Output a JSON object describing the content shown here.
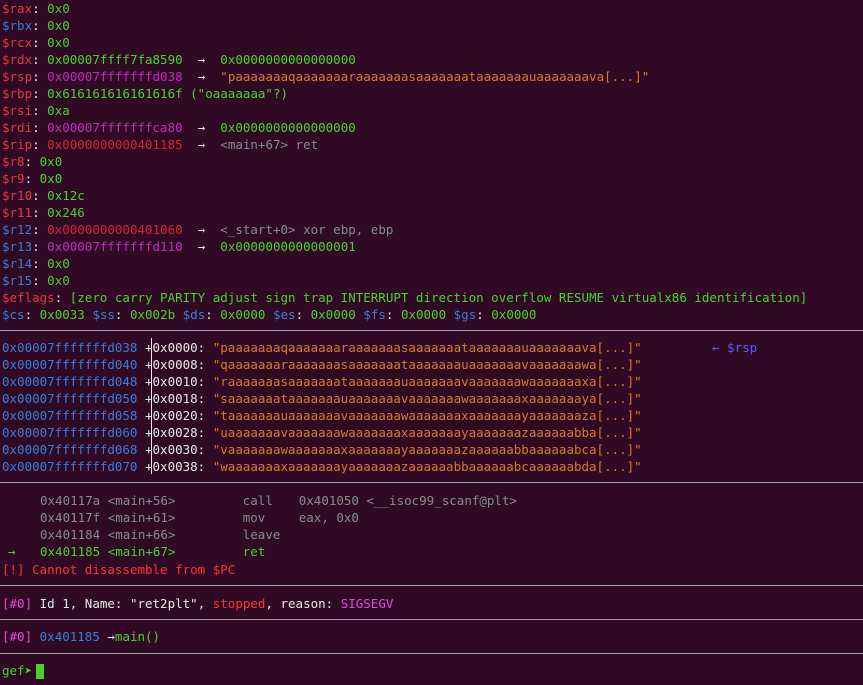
{
  "registers": [
    {
      "name": "$rax",
      "name_color": "red",
      "value": "0x0",
      "value_color": "green",
      "arrow": "",
      "deref": "",
      "deref_color": ""
    },
    {
      "name": "$rbx",
      "name_color": "blue",
      "value": "0x0",
      "value_color": "green",
      "arrow": "",
      "deref": "",
      "deref_color": ""
    },
    {
      "name": "$rcx",
      "name_color": "red",
      "value": "0x0",
      "value_color": "green",
      "arrow": "",
      "deref": "",
      "deref_color": ""
    },
    {
      "name": "$rdx",
      "name_color": "red",
      "value": "0x00007ffff7fa8590",
      "value_color": "green",
      "arrow": "→",
      "deref": "0x0000000000000000",
      "deref_color": "green"
    },
    {
      "name": "$rsp",
      "name_color": "red",
      "value": "0x00007fffffffd038",
      "value_color": "purple",
      "arrow": "→",
      "deref": "\"paaaaaaaqaaaaaaaraaaaaaasaaaaaaataaaaaaauaaaaaaava[...]\"",
      "deref_color": "orange"
    },
    {
      "name": "$rbp",
      "name_color": "red",
      "value": "0x616161616161616f (\"oaaaaaaa\"?)",
      "value_color": "green",
      "arrow": "",
      "deref": "",
      "deref_color": ""
    },
    {
      "name": "$rsi",
      "name_color": "red",
      "value": "0xa",
      "value_color": "green",
      "arrow": "",
      "deref": "",
      "deref_color": ""
    },
    {
      "name": "$rdi",
      "name_color": "red",
      "value": "0x00007fffffffca80",
      "value_color": "purple",
      "arrow": "→",
      "deref": "0x0000000000000000",
      "deref_color": "green"
    },
    {
      "name": "$rip",
      "name_color": "red",
      "value": "0x0000000000401185",
      "value_color": "darkred",
      "arrow": "→",
      "deref": "<main+67> ret",
      "deref_color": "grey"
    },
    {
      "name": "$r8",
      "name_color": "red",
      "value": "0x0",
      "value_color": "green",
      "arrow": "",
      "deref": "",
      "deref_color": ""
    },
    {
      "name": "$r9",
      "name_color": "red",
      "value": "0x0",
      "value_color": "green",
      "arrow": "",
      "deref": "",
      "deref_color": ""
    },
    {
      "name": "$r10",
      "name_color": "red",
      "value": "0x12c",
      "value_color": "green",
      "arrow": "",
      "deref": "",
      "deref_color": ""
    },
    {
      "name": "$r11",
      "name_color": "red",
      "value": "0x246",
      "value_color": "green",
      "arrow": "",
      "deref": "",
      "deref_color": ""
    },
    {
      "name": "$r12",
      "name_color": "blue",
      "value": "0x0000000000401060",
      "value_color": "darkred",
      "arrow": "→",
      "deref": "<_start+0> xor ebp, ebp",
      "deref_color": "grey"
    },
    {
      "name": "$r13",
      "name_color": "blue",
      "value": "0x00007fffffffd110",
      "value_color": "purple",
      "arrow": "→",
      "deref": "0x0000000000000001",
      "deref_color": "green"
    },
    {
      "name": "$r14",
      "name_color": "blue",
      "value": "0x0",
      "value_color": "green",
      "arrow": "",
      "deref": "",
      "deref_color": ""
    },
    {
      "name": "$r15",
      "name_color": "blue",
      "value": "0x0",
      "value_color": "green",
      "arrow": "",
      "deref": "",
      "deref_color": ""
    }
  ],
  "eflags": {
    "name": "$eflags",
    "value": "[zero carry PARITY adjust sign trap INTERRUPT direction overflow RESUME virtualx86 identification]"
  },
  "segments": [
    {
      "name": "$cs",
      "value": "0x0033"
    },
    {
      "name": "$ss",
      "value": "0x002b"
    },
    {
      "name": "$ds",
      "value": "0x0000"
    },
    {
      "name": "$es",
      "value": "0x0000"
    },
    {
      "name": "$fs",
      "value": "0x0000"
    },
    {
      "name": "$gs",
      "value": "0x0000"
    }
  ],
  "stack": [
    {
      "addr": "0x00007fffffffd038",
      "offset": "+0x0000:",
      "value": "\"paaaaaaaqaaaaaaaraaaaaaasaaaaaaataaaaaaauaaaaaaava[...]\"",
      "marker": "← $rsp"
    },
    {
      "addr": "0x00007fffffffd040",
      "offset": "+0x0008:",
      "value": "\"qaaaaaaaraaaaaaasaaaaaaataaaaaaauaaaaaaavaaaaaaawa[...]\"",
      "marker": ""
    },
    {
      "addr": "0x00007fffffffd048",
      "offset": "+0x0010:",
      "value": "\"raaaaaaasaaaaaaataaaaaaauaaaaaaavaaaaaaawaaaaaaaxa[...]\"",
      "marker": ""
    },
    {
      "addr": "0x00007fffffffd050",
      "offset": "+0x0018:",
      "value": "\"saaaaaaataaaaaaauaaaaaaavaaaaaaawaaaaaaaxaaaaaaaya[...]\"",
      "marker": ""
    },
    {
      "addr": "0x00007fffffffd058",
      "offset": "+0x0020:",
      "value": "\"taaaaaaauaaaaaaavaaaaaaawaaaaaaaxaaaaaaayaaaaaaaza[...]\"",
      "marker": ""
    },
    {
      "addr": "0x00007fffffffd060",
      "offset": "+0x0028:",
      "value": "\"uaaaaaaavaaaaaaawaaaaaaaxaaaaaaayaaaaaaazaaaaaabba[...]\"",
      "marker": ""
    },
    {
      "addr": "0x00007fffffffd068",
      "offset": "+0x0030:",
      "value": "\"vaaaaaaawaaaaaaaxaaaaaaayaaaaaaazaaaaaabbaaaaaabca[...]\"",
      "marker": ""
    },
    {
      "addr": "0x00007fffffffd070",
      "offset": "+0x0038:",
      "value": "\"waaaaaaaxaaaaaaayaaaaaaazaaaaaabbaaaaaabcaaaaaabda[...]\"",
      "marker": ""
    }
  ],
  "code": [
    {
      "pointer": "",
      "addr": "0x40117a",
      "sym": "<main+56>",
      "mnemonic": "call",
      "operands": "0x401050 <__isoc99_scanf@plt>",
      "current": false
    },
    {
      "pointer": "",
      "addr": "0x40117f",
      "sym": "<main+61>",
      "mnemonic": "mov",
      "operands": "eax, 0x0",
      "current": false
    },
    {
      "pointer": "",
      "addr": "0x401184",
      "sym": "<main+66>",
      "mnemonic": "leave",
      "operands": "",
      "current": false
    },
    {
      "pointer": "→",
      "addr": "0x401185",
      "sym": "<main+67>",
      "mnemonic": "ret",
      "operands": "",
      "current": true
    }
  ],
  "code_error": {
    "tag": "[!]",
    "text": "Cannot disassemble from $PC"
  },
  "threads": {
    "tag": "[#0]",
    "prefix": "Id 1, Name: ",
    "name": "\"ret2plt\"",
    "mid": ", ",
    "state": "stopped",
    "reason_label": ", reason: ",
    "reason": "SIGSEGV"
  },
  "trace": {
    "tag": "[#0]",
    "addr": "0x401185",
    "arrow": "→",
    "func": "main()"
  },
  "prompt": {
    "text": "gef➤"
  }
}
